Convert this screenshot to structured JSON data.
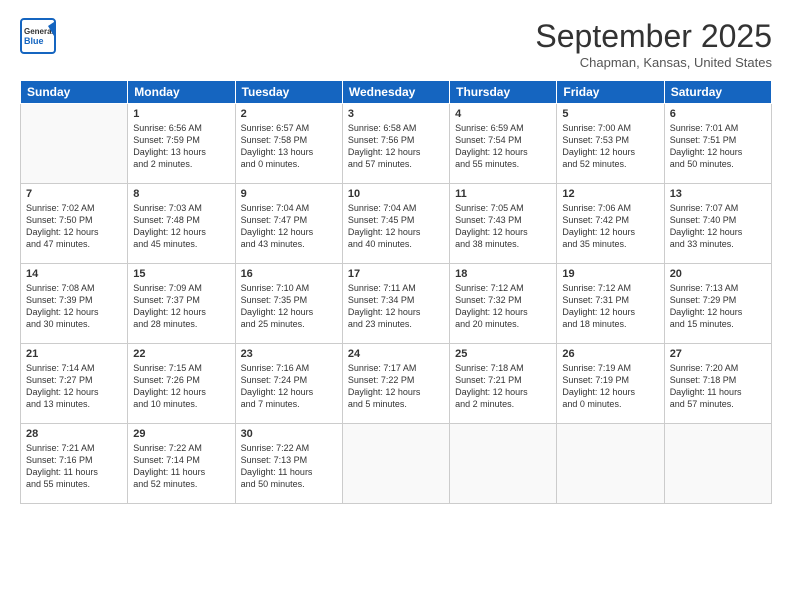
{
  "header": {
    "logo_general": "General",
    "logo_blue": "Blue",
    "month": "September 2025",
    "location": "Chapman, Kansas, United States"
  },
  "weekdays": [
    "Sunday",
    "Monday",
    "Tuesday",
    "Wednesday",
    "Thursday",
    "Friday",
    "Saturday"
  ],
  "weeks": [
    [
      {
        "day": "",
        "info": ""
      },
      {
        "day": "1",
        "info": "Sunrise: 6:56 AM\nSunset: 7:59 PM\nDaylight: 13 hours\nand 2 minutes."
      },
      {
        "day": "2",
        "info": "Sunrise: 6:57 AM\nSunset: 7:58 PM\nDaylight: 13 hours\nand 0 minutes."
      },
      {
        "day": "3",
        "info": "Sunrise: 6:58 AM\nSunset: 7:56 PM\nDaylight: 12 hours\nand 57 minutes."
      },
      {
        "day": "4",
        "info": "Sunrise: 6:59 AM\nSunset: 7:54 PM\nDaylight: 12 hours\nand 55 minutes."
      },
      {
        "day": "5",
        "info": "Sunrise: 7:00 AM\nSunset: 7:53 PM\nDaylight: 12 hours\nand 52 minutes."
      },
      {
        "day": "6",
        "info": "Sunrise: 7:01 AM\nSunset: 7:51 PM\nDaylight: 12 hours\nand 50 minutes."
      }
    ],
    [
      {
        "day": "7",
        "info": "Sunrise: 7:02 AM\nSunset: 7:50 PM\nDaylight: 12 hours\nand 47 minutes."
      },
      {
        "day": "8",
        "info": "Sunrise: 7:03 AM\nSunset: 7:48 PM\nDaylight: 12 hours\nand 45 minutes."
      },
      {
        "day": "9",
        "info": "Sunrise: 7:04 AM\nSunset: 7:47 PM\nDaylight: 12 hours\nand 43 minutes."
      },
      {
        "day": "10",
        "info": "Sunrise: 7:04 AM\nSunset: 7:45 PM\nDaylight: 12 hours\nand 40 minutes."
      },
      {
        "day": "11",
        "info": "Sunrise: 7:05 AM\nSunset: 7:43 PM\nDaylight: 12 hours\nand 38 minutes."
      },
      {
        "day": "12",
        "info": "Sunrise: 7:06 AM\nSunset: 7:42 PM\nDaylight: 12 hours\nand 35 minutes."
      },
      {
        "day": "13",
        "info": "Sunrise: 7:07 AM\nSunset: 7:40 PM\nDaylight: 12 hours\nand 33 minutes."
      }
    ],
    [
      {
        "day": "14",
        "info": "Sunrise: 7:08 AM\nSunset: 7:39 PM\nDaylight: 12 hours\nand 30 minutes."
      },
      {
        "day": "15",
        "info": "Sunrise: 7:09 AM\nSunset: 7:37 PM\nDaylight: 12 hours\nand 28 minutes."
      },
      {
        "day": "16",
        "info": "Sunrise: 7:10 AM\nSunset: 7:35 PM\nDaylight: 12 hours\nand 25 minutes."
      },
      {
        "day": "17",
        "info": "Sunrise: 7:11 AM\nSunset: 7:34 PM\nDaylight: 12 hours\nand 23 minutes."
      },
      {
        "day": "18",
        "info": "Sunrise: 7:12 AM\nSunset: 7:32 PM\nDaylight: 12 hours\nand 20 minutes."
      },
      {
        "day": "19",
        "info": "Sunrise: 7:12 AM\nSunset: 7:31 PM\nDaylight: 12 hours\nand 18 minutes."
      },
      {
        "day": "20",
        "info": "Sunrise: 7:13 AM\nSunset: 7:29 PM\nDaylight: 12 hours\nand 15 minutes."
      }
    ],
    [
      {
        "day": "21",
        "info": "Sunrise: 7:14 AM\nSunset: 7:27 PM\nDaylight: 12 hours\nand 13 minutes."
      },
      {
        "day": "22",
        "info": "Sunrise: 7:15 AM\nSunset: 7:26 PM\nDaylight: 12 hours\nand 10 minutes."
      },
      {
        "day": "23",
        "info": "Sunrise: 7:16 AM\nSunset: 7:24 PM\nDaylight: 12 hours\nand 7 minutes."
      },
      {
        "day": "24",
        "info": "Sunrise: 7:17 AM\nSunset: 7:22 PM\nDaylight: 12 hours\nand 5 minutes."
      },
      {
        "day": "25",
        "info": "Sunrise: 7:18 AM\nSunset: 7:21 PM\nDaylight: 12 hours\nand 2 minutes."
      },
      {
        "day": "26",
        "info": "Sunrise: 7:19 AM\nSunset: 7:19 PM\nDaylight: 12 hours\nand 0 minutes."
      },
      {
        "day": "27",
        "info": "Sunrise: 7:20 AM\nSunset: 7:18 PM\nDaylight: 11 hours\nand 57 minutes."
      }
    ],
    [
      {
        "day": "28",
        "info": "Sunrise: 7:21 AM\nSunset: 7:16 PM\nDaylight: 11 hours\nand 55 minutes."
      },
      {
        "day": "29",
        "info": "Sunrise: 7:22 AM\nSunset: 7:14 PM\nDaylight: 11 hours\nand 52 minutes."
      },
      {
        "day": "30",
        "info": "Sunrise: 7:22 AM\nSunset: 7:13 PM\nDaylight: 11 hours\nand 50 minutes."
      },
      {
        "day": "",
        "info": ""
      },
      {
        "day": "",
        "info": ""
      },
      {
        "day": "",
        "info": ""
      },
      {
        "day": "",
        "info": ""
      }
    ]
  ]
}
